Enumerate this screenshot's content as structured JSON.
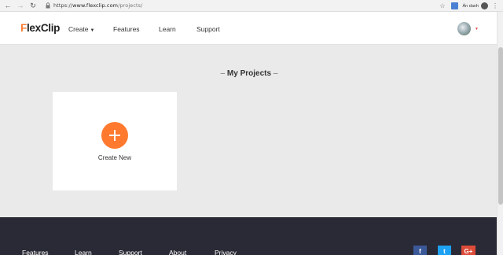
{
  "browser": {
    "url_scheme": "https://",
    "url_host": "www.flexclip.com",
    "url_path": "/projects/",
    "incognito_label": "Ẩn danh"
  },
  "icons": {
    "back": "back-arrow-icon",
    "forward": "forward-arrow-icon",
    "reload": "reload-icon",
    "lock": "lock-icon",
    "star": "star-icon",
    "translate": "translate-icon",
    "incognito": "incognito-icon",
    "menu": "kebab-menu-icon"
  },
  "header": {
    "logo_f": "F",
    "logo_rest": "lexClip",
    "nav": {
      "create": "Create",
      "features": "Features",
      "learn": "Learn",
      "support": "Support"
    }
  },
  "main": {
    "title": "My Projects",
    "create_new": "Create New"
  },
  "footer": {
    "links": {
      "features": "Features",
      "learn": "Learn",
      "support": "Support",
      "about": "About",
      "privacy": "Privacy"
    },
    "social": {
      "facebook": "f",
      "twitter": "t",
      "gplus": "G+"
    }
  },
  "colors": {
    "accent": "#ff7a2f",
    "footer_bg": "#2a2a36",
    "page_bg": "#eaeaea"
  }
}
